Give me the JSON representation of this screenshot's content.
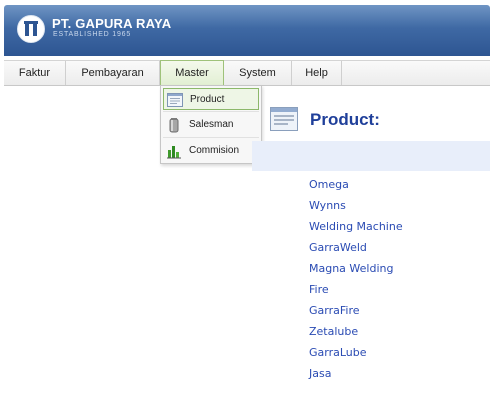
{
  "header": {
    "company": "PT. GAPURA RAYA",
    "tagline": "ESTABLISHED 1965"
  },
  "menu": [
    {
      "label": "Faktur"
    },
    {
      "label": "Pembayaran"
    },
    {
      "label": "Master"
    },
    {
      "label": "System"
    },
    {
      "label": "Help"
    }
  ],
  "dropdown": {
    "items": [
      {
        "label": "Product",
        "icon": "product-form-icon"
      },
      {
        "label": "Salesman",
        "icon": "salesman-icon"
      },
      {
        "label": "Commision",
        "icon": "commission-chart-icon"
      }
    ]
  },
  "page": {
    "title": "Product:",
    "icon": "product-form-icon"
  },
  "products": [
    "Omega",
    "Wynns",
    "Welding Machine",
    "GarraWeld",
    "Magna Welding",
    "Fire",
    "GarraFire",
    "Zetalube",
    "GarraLube",
    "Jasa"
  ],
  "colors": {
    "header_blue": "#3f69a4",
    "link_blue": "#2a4bb3",
    "title_blue": "#1f3f9a",
    "active_green": "#9fc27a"
  }
}
